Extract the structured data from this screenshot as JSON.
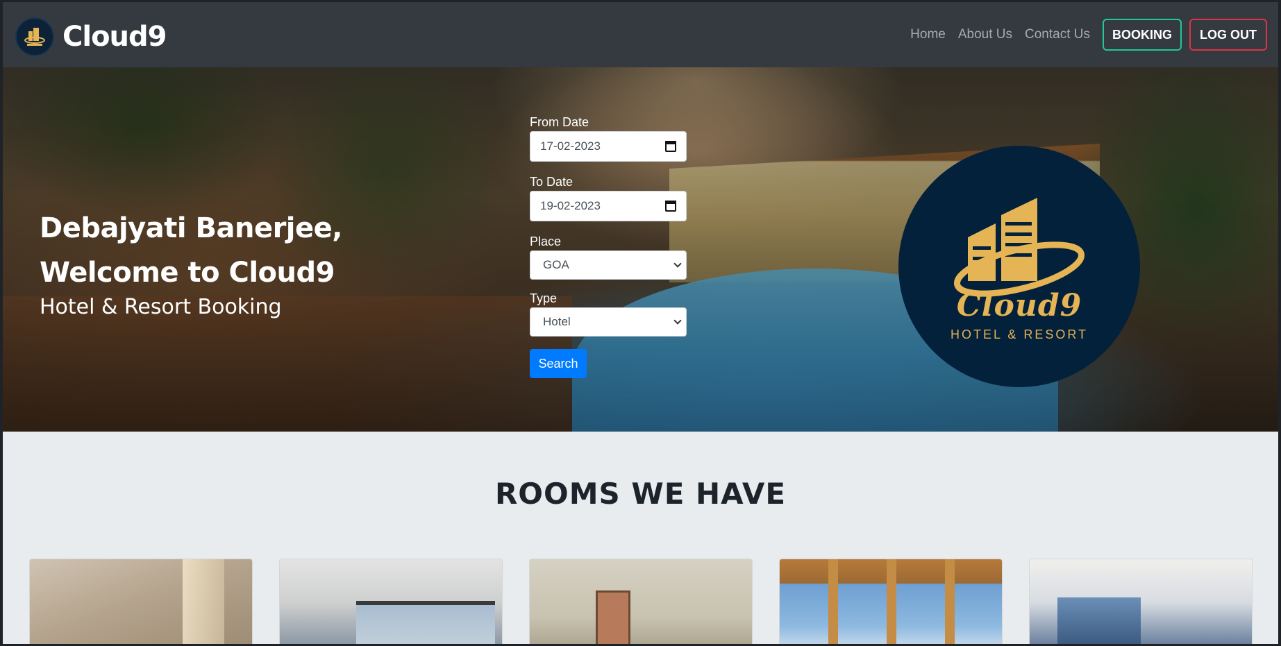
{
  "brand": {
    "name": "Cloud9",
    "logo_icon": "cloud9-logo-icon"
  },
  "nav": {
    "links": [
      "Home",
      "About Us",
      "Contact Us"
    ],
    "booking_label": "BOOKING",
    "logout_label": "LOG OUT",
    "booking_color": "#20c997",
    "logout_color": "#dc3545"
  },
  "hero": {
    "greeting_name": "Debajyati Banerjee,",
    "welcome": "Welcome to Cloud9",
    "subtitle": "Hotel & Resort Booking"
  },
  "search_form": {
    "from_label": "From Date",
    "from_value": "17-02-2023",
    "to_label": "To Date",
    "to_value": "19-02-2023",
    "place_label": "Place",
    "place_value": "GOA",
    "type_label": "Type",
    "type_value": "Hotel",
    "search_label": "Search",
    "search_color": "#007bff"
  },
  "logo_badge": {
    "title": "Cloud9",
    "subtitle": "HOTEL & RESORT",
    "color": "#e4b455",
    "bg": "#04213c"
  },
  "rooms": {
    "title": "ROOMS WE HAVE",
    "cards": [
      "room-image-1",
      "room-image-2",
      "room-image-3",
      "room-image-4",
      "room-image-5"
    ]
  }
}
